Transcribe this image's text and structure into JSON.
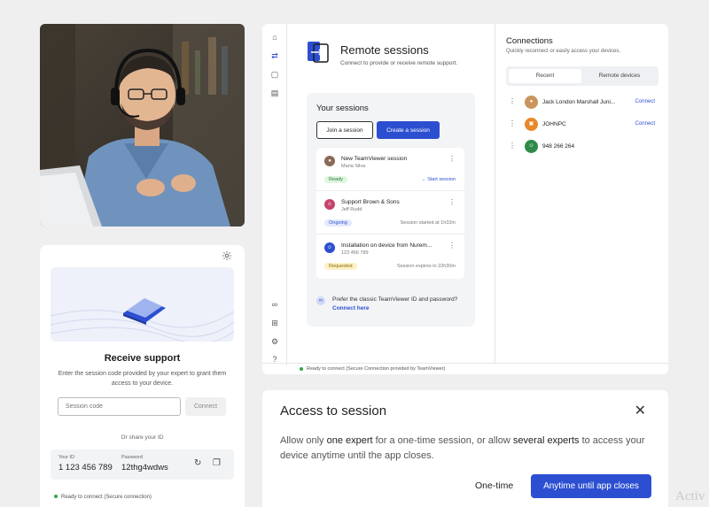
{
  "receive": {
    "title": "Receive support",
    "description": "Enter the session code provided by your expert to grant them access to your device.",
    "code_placeholder": "Session code",
    "connect_label": "Connect",
    "or_share": "Or share your ID",
    "id_label": "Your ID",
    "id_value": "1 123 456 789",
    "password_label": "Password",
    "password_value": "12thg4wdws",
    "status": "Ready to connect (Secure connection)"
  },
  "app": {
    "title": "Remote sessions",
    "subtitle": "Connect to provide or receive remote support.",
    "status": "Ready to connect (Secure Connection provided by TeamViewer)",
    "your_sessions": "Your sessions",
    "join_label": "Join a session",
    "create_label": "Create a session",
    "sessions": [
      {
        "name": "New TeamViewer session",
        "sub": "Maria Silva",
        "badge": "Ready",
        "right": "→ Start session"
      },
      {
        "name": "Support Brown & Sons",
        "sub": "Jeff Rudd",
        "badge": "Ongoing",
        "right": "Session started at 1h32m"
      },
      {
        "name": "Installation on device from Nurem...",
        "sub": "123 456 789",
        "badge": "Requested",
        "right": "Session expires in 22h30m"
      }
    ],
    "classic_question": "Prefer the classic TeamViewer ID and password?",
    "classic_link": "Connect here",
    "connections": {
      "title": "Connections",
      "subtitle": "Quickly reconnect or easily access your devices.",
      "tab_recent": "Recent",
      "tab_remote": "Remote devices",
      "items": [
        {
          "name": "Jack London Marshall Juni...",
          "action": "Connect"
        },
        {
          "name": "JOHNPC",
          "action": "Connect"
        },
        {
          "name": "948 266 264",
          "action": ""
        }
      ]
    }
  },
  "access": {
    "title": "Access to session",
    "body_1": "Allow only ",
    "body_2": "one expert",
    "body_3": " for a one-time session, or allow ",
    "body_4": "several experts",
    "body_5": " to access your device anytime until the app closes.",
    "one_time_label": "One-time",
    "anytime_label": "Anytime until app closes"
  },
  "watermark": "Activ",
  "colors": {
    "accent": "#2c4fd1",
    "ready": "#dff5df",
    "ongoing": "#e3eafc",
    "requested": "#fdf1c4"
  }
}
